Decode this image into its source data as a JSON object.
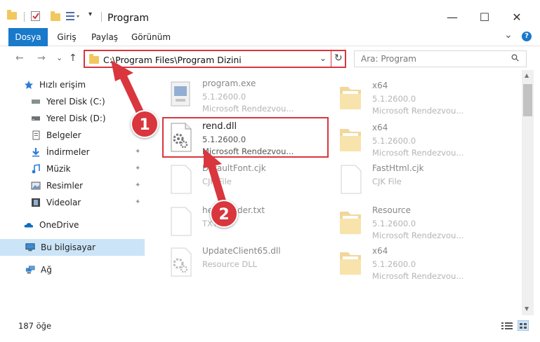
{
  "window": {
    "title": "Program",
    "minimize": "—",
    "maximize": "☐",
    "close": "✕"
  },
  "ribbon": {
    "tabs": [
      "Dosya",
      "Giriş",
      "Paylaş",
      "Görünüm"
    ],
    "expand": "⌄",
    "help": "?"
  },
  "nav": {
    "back": "←",
    "forward": "→",
    "recent": "⌄",
    "up": "↑"
  },
  "address": {
    "path": "C:\\Program Files\\Program Dizini",
    "dropdown": "⌄",
    "refresh": "↻"
  },
  "search": {
    "placeholder": "Ara: Program",
    "icon": "⚲"
  },
  "sidebar": {
    "items": [
      {
        "label": "Hızlı erişim",
        "icon": "star-icon"
      },
      {
        "label": "Yerel Disk (C:)",
        "icon": "drive-icon",
        "pinned": true
      },
      {
        "label": "Yerel Disk (D:)",
        "icon": "drive-icon",
        "pinned": true
      },
      {
        "label": "Belgeler",
        "icon": "documents-icon",
        "pinned": true
      },
      {
        "label": "İndirmeler",
        "icon": "download-icon",
        "pinned": true
      },
      {
        "label": "Müzik",
        "icon": "music-icon",
        "pinned": true
      },
      {
        "label": "Resimler",
        "icon": "pictures-icon",
        "pinned": true
      },
      {
        "label": "Videolar",
        "icon": "videos-icon",
        "pinned": true
      },
      {
        "label": "OneDrive",
        "icon": "cloud-icon"
      },
      {
        "label": "Bu bilgisayar",
        "icon": "computer-icon",
        "selected": true
      },
      {
        "label": "Ağ",
        "icon": "network-icon"
      }
    ],
    "pin_glyph": "📌"
  },
  "files": [
    {
      "name": "program.exe",
      "version": "5.1.2600.0",
      "desc": "Microsoft Rendezvou...",
      "icon": "exe-icon"
    },
    {
      "name": "x64",
      "version": "5.1.2600.0",
      "desc": "Microsoft Rendezvou...",
      "icon": "folder-icon"
    },
    {
      "name": "rend.dll",
      "version": "5.1.2600.0",
      "desc": "Microsoft Rendezvou...",
      "icon": "dll-gear-icon"
    },
    {
      "name": "x64",
      "version": "5.1.2600.0",
      "desc": "Microsoft Rendezvou...",
      "icon": "folder-icon"
    },
    {
      "name": "DefaultFont.cjk",
      "version": "CJK File",
      "desc": "",
      "icon": "file-icon"
    },
    {
      "name": "FastHtml.cjk",
      "version": "CJK File",
      "desc": "",
      "icon": "file-icon"
    },
    {
      "name": "help_loader.txt",
      "version": "TXT",
      "desc": "",
      "icon": "file-icon"
    },
    {
      "name": "Resource",
      "version": "5.1.2600.0",
      "desc": "Microsoft Rendezvou...",
      "icon": "folder-icon"
    },
    {
      "name": "UpdateClient65.dll",
      "version": "Resource DLL",
      "desc": "",
      "icon": "dll-gear-icon"
    },
    {
      "name": "x64",
      "version": "5.1.2600.0",
      "desc": "Microsoft Rendezvou...",
      "icon": "folder-icon"
    }
  ],
  "annotations": {
    "one": "1",
    "two": "2"
  },
  "status": {
    "count": "187 öğe"
  },
  "colors": {
    "accent": "#1979ca",
    "highlight": "#d9363e",
    "selected": "#cce4f7"
  }
}
